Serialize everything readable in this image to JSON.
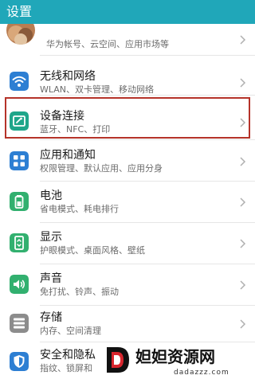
{
  "header": {
    "title": "设置"
  },
  "account": {
    "subtitle": "华为帐号、云空间、应用市场等"
  },
  "settings": [
    {
      "title": "无线和网络",
      "subtitle": "WLAN、双卡管理、移动网络",
      "icon": "wifi-icon"
    },
    {
      "title": "设备连接",
      "subtitle": "蓝牙、NFC、打印",
      "icon": "device-connection-icon"
    },
    {
      "title": "应用和通知",
      "subtitle": "权限管理、默认应用、应用分身",
      "icon": "apps-icon"
    },
    {
      "title": "电池",
      "subtitle": "省电模式、耗电排行",
      "icon": "battery-icon"
    },
    {
      "title": "显示",
      "subtitle": "护眼模式、桌面风格、壁纸",
      "icon": "display-icon"
    },
    {
      "title": "声音",
      "subtitle": "免打扰、铃声、振动",
      "icon": "sound-icon"
    },
    {
      "title": "存储",
      "subtitle": "内存、空间清理",
      "icon": "storage-icon"
    },
    {
      "title": "安全和隐私",
      "subtitle": "指纹、锁屏和",
      "icon": "security-icon"
    }
  ],
  "watermark": {
    "title": "妲妲资源网",
    "url": "dadazzz.com"
  },
  "colors": {
    "header": "#20a7b9",
    "highlight_border": "#b53329",
    "title_text": "#1a1a1a",
    "subtitle_text": "#6b6b6b",
    "icon_blue": "#2d7fd3",
    "icon_teal": "#1fa68a",
    "icon_green": "#32b06f",
    "icon_gray": "#8c8c8c"
  }
}
